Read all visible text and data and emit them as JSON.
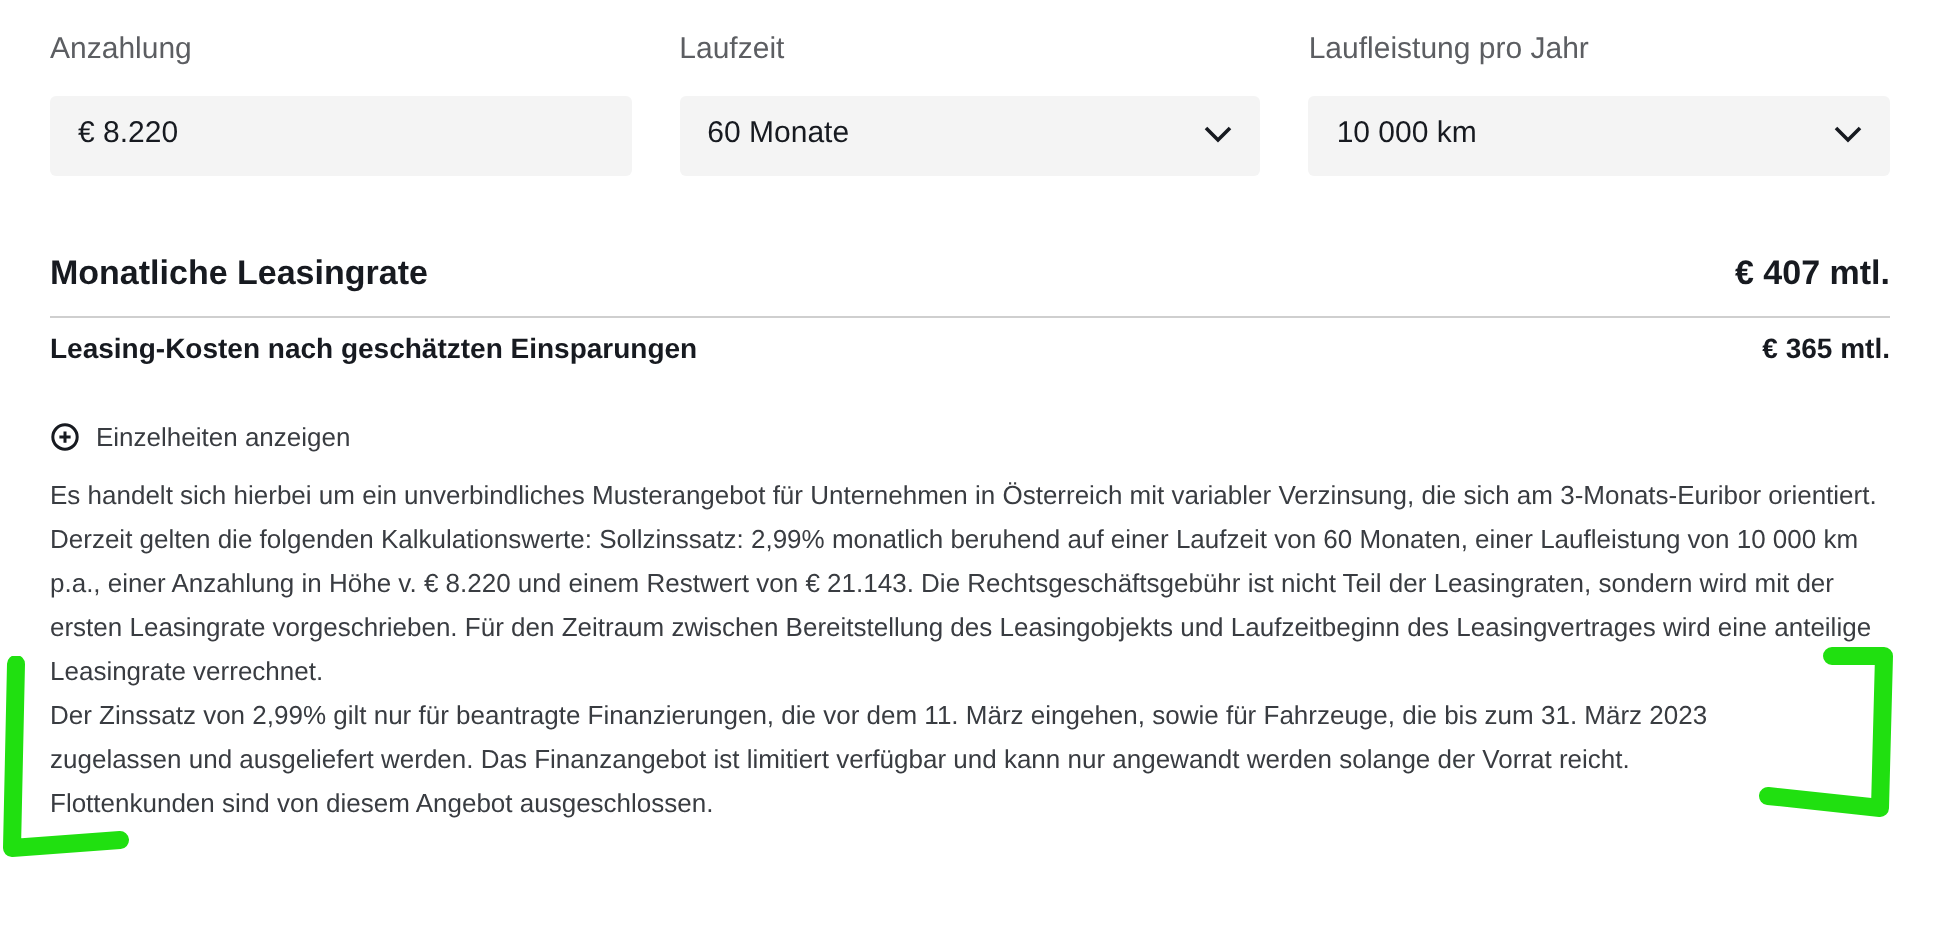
{
  "fields": [
    {
      "kind": "input",
      "label": "Anzahlung",
      "value": "€ 8.220"
    },
    {
      "kind": "select",
      "label": "Laufzeit",
      "value": "60 Monate"
    },
    {
      "kind": "select",
      "label": "Laufleistung pro Jahr",
      "value": "10 000 km"
    }
  ],
  "monthly_rate": {
    "label": "Monatliche Leasingrate",
    "value": "€ 407 mtl."
  },
  "after_savings": {
    "label": "Leasing-Kosten nach geschätzten Einsparungen",
    "value": "€ 365 mtl."
  },
  "details_toggle": {
    "label": "Einzelheiten anzeigen",
    "expanded": false
  },
  "disclaimer": [
    "Es handelt sich hierbei um ein unverbindliches Musterangebot für Unternehmen in Österreich mit variabler Verzinsung, die sich am 3-Monats-Euribor orientiert. Derzeit gelten die folgenden Kalkulationswerte: Sollzinssatz: 2,99% monatlich beruhend auf einer Laufzeit von 60 Monaten, einer Laufleistung von 10 000 km p.a., einer Anzahlung in Höhe v. € 8.220 und einem Restwert von € 21.143. Die Rechtsgeschäftsgebühr ist nicht Teil der Leasingraten, sondern wird mit der ersten Leasingrate vorgeschrieben. Für den Zeitraum zwischen Bereitstellung des Leasingobjekts und Laufzeitbeginn des Leasingvertrages wird eine anteilige Leasingrate verrechnet.",
    "Der Zinssatz von 2,99% gilt nur für beantragte Finanzierungen, die vor dem 11. März eingehen, sowie für Fahrzeuge, die bis zum 31. März 2023 zugelassen und ausgeliefert werden. Das Finanzangebot ist limitiert verfügbar und kann nur angewandt werden solange der Vorrat reicht. Flottenkunden sind von diesem Angebot ausgeschlossen."
  ],
  "highlight_marks": {
    "left_bracket": true,
    "right_bracket": true
  }
}
